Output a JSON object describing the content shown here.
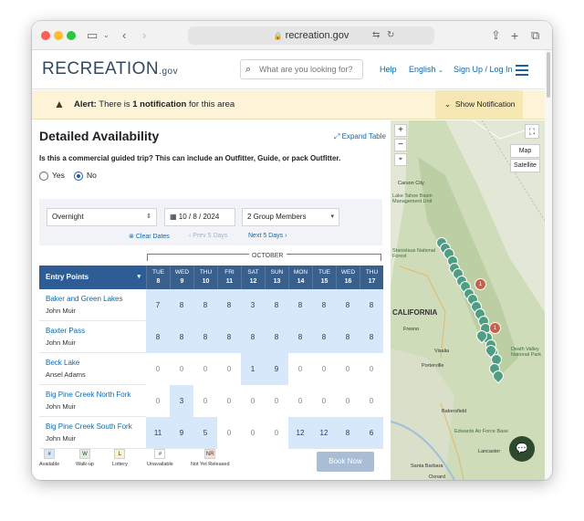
{
  "browser": {
    "url": "recreation.gov"
  },
  "header": {
    "logo_text": "RECREATION",
    "logo_suffix": ".gov",
    "search_placeholder": "What are you looking for?",
    "help": "Help",
    "language": "English",
    "signup": "Sign Up / Log In"
  },
  "alert": {
    "label": "Alert:",
    "text_before": "There is ",
    "count": "1 notification",
    "text_after": " for this area",
    "button": "Show Notification"
  },
  "availability": {
    "title": "Detailed Availability",
    "expand": "Expand Table",
    "question": "Is this a commercial guided trip? This can include an Outfitter, Guide, or pack Outfitter.",
    "yes": "Yes",
    "no": "No",
    "selected": "No",
    "filters": {
      "type": "Overnight",
      "date": "10 / 8 / 2024",
      "group": "2 Group Members",
      "clear": "Clear Dates",
      "prev": "Prev 5 Days",
      "next": "Next 5 Days"
    },
    "month": "OCTOBER",
    "entry_header": "Entry Points",
    "days": [
      {
        "dow": "TUE",
        "num": "8"
      },
      {
        "dow": "WED",
        "num": "9"
      },
      {
        "dow": "THU",
        "num": "10"
      },
      {
        "dow": "FRI",
        "num": "11"
      },
      {
        "dow": "SAT",
        "num": "12"
      },
      {
        "dow": "SUN",
        "num": "13"
      },
      {
        "dow": "MON",
        "num": "14"
      },
      {
        "dow": "TUE",
        "num": "15"
      },
      {
        "dow": "WED",
        "num": "16"
      },
      {
        "dow": "THU",
        "num": "17"
      }
    ],
    "rows": [
      {
        "name": "Baker and Green Lakes",
        "area": "John Muir",
        "values": [
          "7",
          "8",
          "8",
          "8",
          "3",
          "8",
          "8",
          "8",
          "8",
          "8"
        ]
      },
      {
        "name": "Baxter Pass",
        "area": "John Muir",
        "values": [
          "8",
          "8",
          "8",
          "8",
          "8",
          "8",
          "8",
          "8",
          "8",
          "8"
        ]
      },
      {
        "name": "Beck Lake",
        "area": "Ansel Adams",
        "values": [
          "0",
          "0",
          "0",
          "0",
          "1",
          "9",
          "0",
          "0",
          "0",
          "0"
        ]
      },
      {
        "name": "Big Pine Creek North Fork",
        "area": "John Muir",
        "values": [
          "0",
          "3",
          "0",
          "0",
          "0",
          "0",
          "0",
          "0",
          "0",
          "0"
        ]
      },
      {
        "name": "Big Pine Creek South Fork",
        "area": "John Muir",
        "values": [
          "11",
          "9",
          "5",
          "0",
          "0",
          "0",
          "12",
          "12",
          "8",
          "6"
        ]
      }
    ],
    "legend": [
      {
        "code": "#",
        "label": "Available",
        "color": "#d7e8fb"
      },
      {
        "code": "W",
        "label": "Walk-up",
        "color": "#dff2df"
      },
      {
        "code": "L",
        "label": "Lottery",
        "color": "#fdf2c8"
      },
      {
        "code": "#",
        "label": "Unavailable",
        "color": "#ffffff"
      },
      {
        "code": "NR",
        "label": "Not Yet Released",
        "color": "#f6e0d3"
      }
    ],
    "book": "Book Now"
  },
  "map": {
    "zoom_in": "+",
    "zoom_out": "−",
    "map_btn": "Map",
    "satellite_btn": "Satellite",
    "labels": [
      "Carson City",
      "Lake Tahoe Basin Management Unit",
      "Stanislaus National Forest",
      "CALIFORNIA",
      "Fresno",
      "Visalia",
      "Porterville",
      "Bakersfield",
      "Edwards Air Force Base",
      "Lancaster",
      "Death Valley National Park",
      "Santa Barbara",
      "Oxnard"
    ],
    "pin_numbers": [
      "1",
      "1"
    ]
  }
}
